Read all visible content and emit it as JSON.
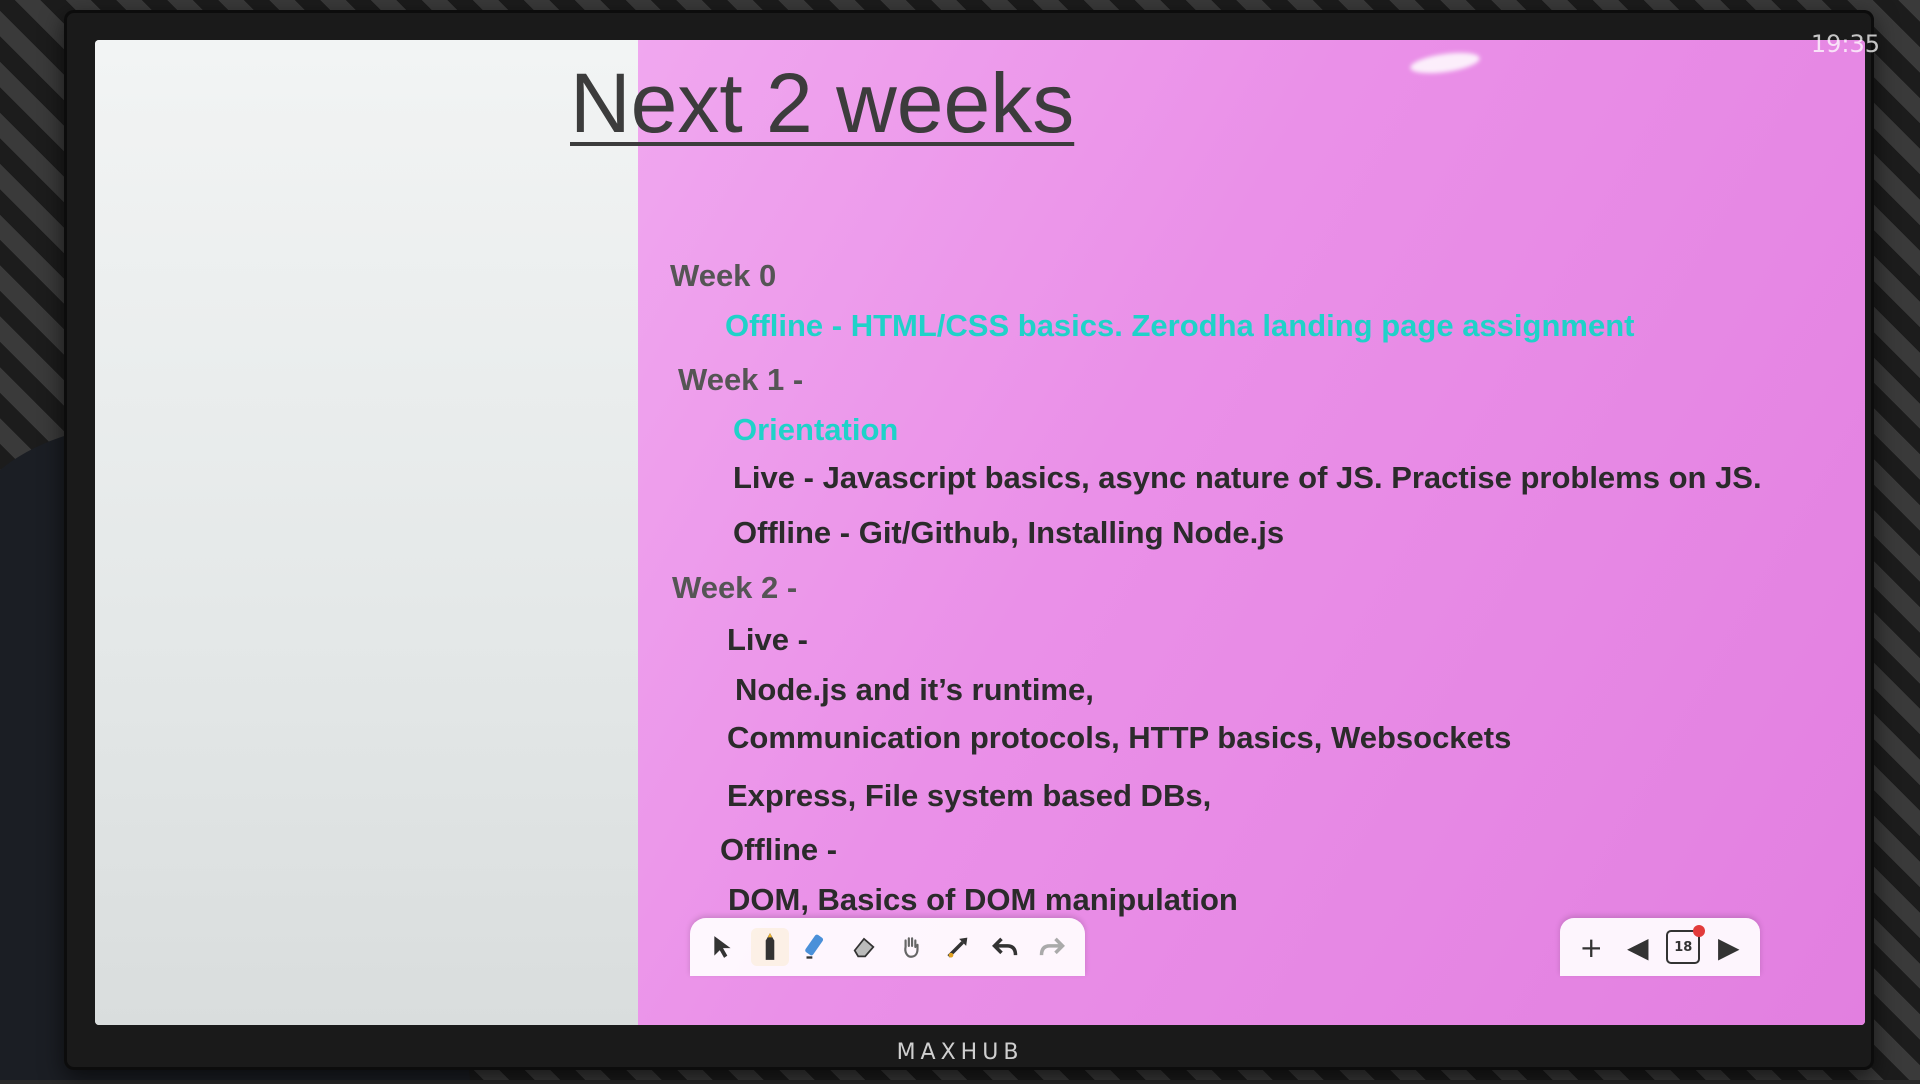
{
  "display": {
    "brand": "MAXHUB",
    "clock": "19:35"
  },
  "slide": {
    "title": "Next 2 weeks",
    "lines": [
      {
        "text": "Week 0"
      },
      {
        "text": "Offline - HTML/CSS basics. Zerodha landing page assignment"
      },
      {
        "text": "Week 1 -"
      },
      {
        "text": "Orientation"
      },
      {
        "text": "Live - Javascript basics, async nature of JS. Practise problems on JS."
      },
      {
        "text": "Offline - Git/Github, Installing Node.js"
      },
      {
        "text": "Week 2 -"
      },
      {
        "text": "Live -"
      },
      {
        "text": "Node.js and it’s runtime,"
      },
      {
        "text": "Communication protocols, HTTP basics, Websockets"
      },
      {
        "text": "Express, File system based DBs,"
      },
      {
        "text": "Offline -"
      },
      {
        "text": "DOM, Basics of DOM manipulation"
      }
    ]
  },
  "toolbar": {
    "tools": [
      {
        "name": "select-tool",
        "icon": "cursor-arrow-icon"
      },
      {
        "name": "pen-tool",
        "icon": "pen-icon"
      },
      {
        "name": "highlighter-tool",
        "icon": "highlighter-icon"
      },
      {
        "name": "eraser-tool",
        "icon": "eraser-icon"
      },
      {
        "name": "pan-tool",
        "icon": "hand-icon"
      },
      {
        "name": "pointer-tool",
        "icon": "laser-pointer-icon"
      },
      {
        "name": "undo-tool",
        "icon": "undo-icon"
      },
      {
        "name": "redo-tool",
        "icon": "redo-icon"
      }
    ]
  },
  "page_nav": {
    "page_number": "18"
  },
  "colors": {
    "accent_text": "#1fd2c9",
    "slide_bg": "#ea90e8",
    "body_text": "#2b2b2b"
  }
}
